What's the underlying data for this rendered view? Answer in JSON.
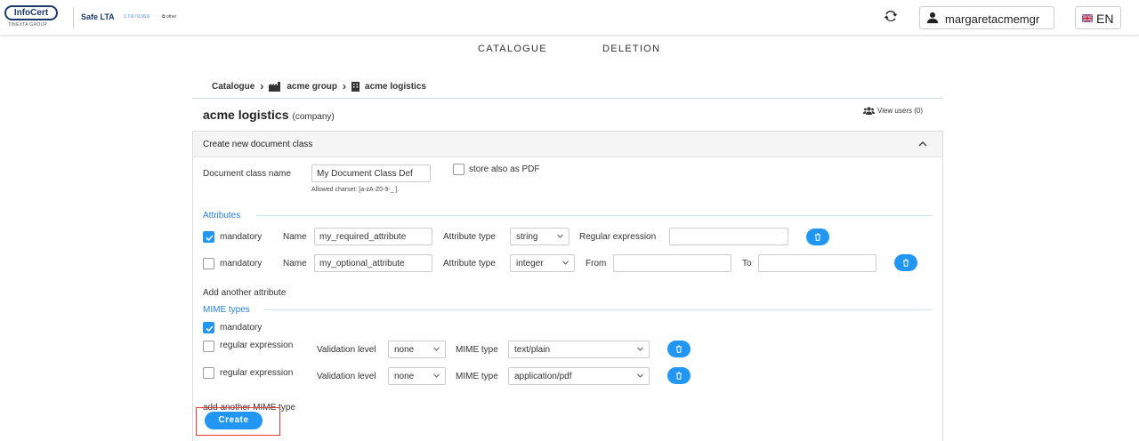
{
  "brand": {
    "logo_text": "InfoCert",
    "logo_sub": "TINEXTA GROUP",
    "app_name": "Safe LTA",
    "version": "1.7.6 / 0.16.6",
    "other_link": "other"
  },
  "header": {
    "username": "margaretacmemgr",
    "language": "EN"
  },
  "nav": {
    "catalogue": "CATALOGUE",
    "deletion": "DELETION"
  },
  "breadcrumb": {
    "root": "Catalogue",
    "group": "acme group",
    "company": "acme logistics"
  },
  "page": {
    "title": "acme logistics",
    "entity_type": "(company)",
    "view_users": "View users (0)"
  },
  "panel": {
    "title": "Create new document class"
  },
  "form": {
    "doc_class_label": "Document class name",
    "doc_class_value": "My Document Class Def",
    "store_pdf_label": "store also as PDF",
    "charset_hint": "Allowed charset: [a-zA-Z0-9-_  ].",
    "attributes_section": "Attributes",
    "attributes": [
      {
        "mandatory_label": "mandatory",
        "mandatory": true,
        "name_label": "Name",
        "name": "my_required_attribute",
        "type_label": "Attribute type",
        "type": "string",
        "extra1_label": "Regular expression",
        "extra1_value": ""
      },
      {
        "mandatory_label": "mandatory",
        "mandatory": false,
        "name_label": "Name",
        "name": "my_optional_attribute",
        "type_label": "Attribute type",
        "type": "integer",
        "extra1_label": "From",
        "extra1_value": "",
        "extra2_label": "To",
        "extra2_value": ""
      }
    ],
    "add_attribute": "Add another attribute",
    "mime_section": "MIME types",
    "mime_mandatory_label": "mandatory",
    "mime_rows": [
      {
        "regex_label": "regular expression",
        "regex": false,
        "level_label": "Validation level",
        "level": "none",
        "mime_label": "MIME type",
        "mime": "text/plain"
      },
      {
        "regex_label": "regular expression",
        "regex": false,
        "level_label": "Validation level",
        "level": "none",
        "mime_label": "MIME type",
        "mime": "application/pdf"
      }
    ],
    "add_mime": "add another MIME type",
    "create_button": "Create"
  },
  "colors": {
    "accent": "#2196f3",
    "section_text": "#2a7de1",
    "highlight": "#e53935",
    "brand": "#1b3a6b"
  }
}
